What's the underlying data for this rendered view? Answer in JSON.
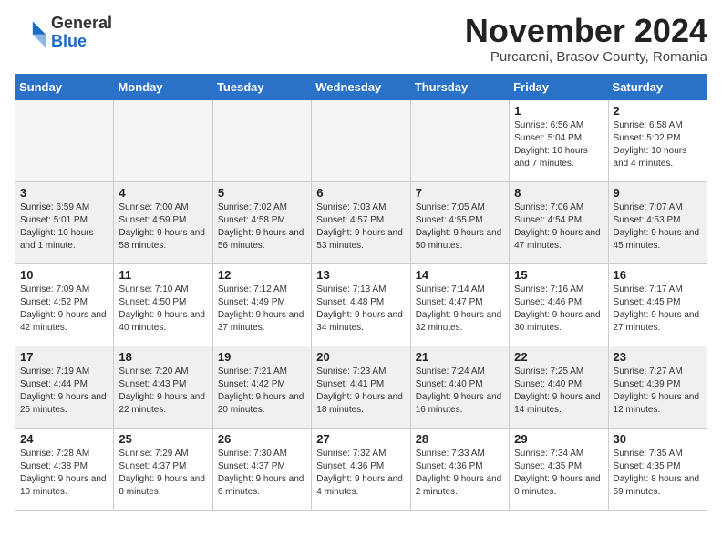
{
  "header": {
    "logo_general": "General",
    "logo_blue": "Blue",
    "month_title": "November 2024",
    "location": "Purcareni, Brasov County, Romania"
  },
  "weekdays": [
    "Sunday",
    "Monday",
    "Tuesday",
    "Wednesday",
    "Thursday",
    "Friday",
    "Saturday"
  ],
  "weeks": [
    [
      {
        "day": "",
        "info": ""
      },
      {
        "day": "",
        "info": ""
      },
      {
        "day": "",
        "info": ""
      },
      {
        "day": "",
        "info": ""
      },
      {
        "day": "",
        "info": ""
      },
      {
        "day": "1",
        "info": "Sunrise: 6:56 AM\nSunset: 5:04 PM\nDaylight: 10 hours and 7 minutes."
      },
      {
        "day": "2",
        "info": "Sunrise: 6:58 AM\nSunset: 5:02 PM\nDaylight: 10 hours and 4 minutes."
      }
    ],
    [
      {
        "day": "3",
        "info": "Sunrise: 6:59 AM\nSunset: 5:01 PM\nDaylight: 10 hours and 1 minute."
      },
      {
        "day": "4",
        "info": "Sunrise: 7:00 AM\nSunset: 4:59 PM\nDaylight: 9 hours and 58 minutes."
      },
      {
        "day": "5",
        "info": "Sunrise: 7:02 AM\nSunset: 4:58 PM\nDaylight: 9 hours and 56 minutes."
      },
      {
        "day": "6",
        "info": "Sunrise: 7:03 AM\nSunset: 4:57 PM\nDaylight: 9 hours and 53 minutes."
      },
      {
        "day": "7",
        "info": "Sunrise: 7:05 AM\nSunset: 4:55 PM\nDaylight: 9 hours and 50 minutes."
      },
      {
        "day": "8",
        "info": "Sunrise: 7:06 AM\nSunset: 4:54 PM\nDaylight: 9 hours and 47 minutes."
      },
      {
        "day": "9",
        "info": "Sunrise: 7:07 AM\nSunset: 4:53 PM\nDaylight: 9 hours and 45 minutes."
      }
    ],
    [
      {
        "day": "10",
        "info": "Sunrise: 7:09 AM\nSunset: 4:52 PM\nDaylight: 9 hours and 42 minutes."
      },
      {
        "day": "11",
        "info": "Sunrise: 7:10 AM\nSunset: 4:50 PM\nDaylight: 9 hours and 40 minutes."
      },
      {
        "day": "12",
        "info": "Sunrise: 7:12 AM\nSunset: 4:49 PM\nDaylight: 9 hours and 37 minutes."
      },
      {
        "day": "13",
        "info": "Sunrise: 7:13 AM\nSunset: 4:48 PM\nDaylight: 9 hours and 34 minutes."
      },
      {
        "day": "14",
        "info": "Sunrise: 7:14 AM\nSunset: 4:47 PM\nDaylight: 9 hours and 32 minutes."
      },
      {
        "day": "15",
        "info": "Sunrise: 7:16 AM\nSunset: 4:46 PM\nDaylight: 9 hours and 30 minutes."
      },
      {
        "day": "16",
        "info": "Sunrise: 7:17 AM\nSunset: 4:45 PM\nDaylight: 9 hours and 27 minutes."
      }
    ],
    [
      {
        "day": "17",
        "info": "Sunrise: 7:19 AM\nSunset: 4:44 PM\nDaylight: 9 hours and 25 minutes."
      },
      {
        "day": "18",
        "info": "Sunrise: 7:20 AM\nSunset: 4:43 PM\nDaylight: 9 hours and 22 minutes."
      },
      {
        "day": "19",
        "info": "Sunrise: 7:21 AM\nSunset: 4:42 PM\nDaylight: 9 hours and 20 minutes."
      },
      {
        "day": "20",
        "info": "Sunrise: 7:23 AM\nSunset: 4:41 PM\nDaylight: 9 hours and 18 minutes."
      },
      {
        "day": "21",
        "info": "Sunrise: 7:24 AM\nSunset: 4:40 PM\nDaylight: 9 hours and 16 minutes."
      },
      {
        "day": "22",
        "info": "Sunrise: 7:25 AM\nSunset: 4:40 PM\nDaylight: 9 hours and 14 minutes."
      },
      {
        "day": "23",
        "info": "Sunrise: 7:27 AM\nSunset: 4:39 PM\nDaylight: 9 hours and 12 minutes."
      }
    ],
    [
      {
        "day": "24",
        "info": "Sunrise: 7:28 AM\nSunset: 4:38 PM\nDaylight: 9 hours and 10 minutes."
      },
      {
        "day": "25",
        "info": "Sunrise: 7:29 AM\nSunset: 4:37 PM\nDaylight: 9 hours and 8 minutes."
      },
      {
        "day": "26",
        "info": "Sunrise: 7:30 AM\nSunset: 4:37 PM\nDaylight: 9 hours and 6 minutes."
      },
      {
        "day": "27",
        "info": "Sunrise: 7:32 AM\nSunset: 4:36 PM\nDaylight: 9 hours and 4 minutes."
      },
      {
        "day": "28",
        "info": "Sunrise: 7:33 AM\nSunset: 4:36 PM\nDaylight: 9 hours and 2 minutes."
      },
      {
        "day": "29",
        "info": "Sunrise: 7:34 AM\nSunset: 4:35 PM\nDaylight: 9 hours and 0 minutes."
      },
      {
        "day": "30",
        "info": "Sunrise: 7:35 AM\nSunset: 4:35 PM\nDaylight: 8 hours and 59 minutes."
      }
    ]
  ]
}
